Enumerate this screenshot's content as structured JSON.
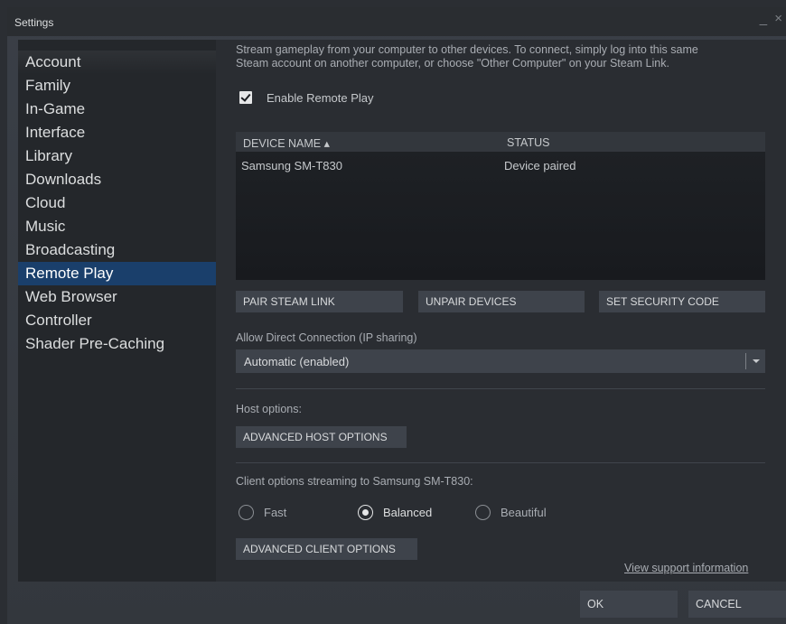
{
  "window": {
    "title": "Settings",
    "controls": "_ ×"
  },
  "sidebar": {
    "items": [
      {
        "label": "Account"
      },
      {
        "label": "Family"
      },
      {
        "label": "In-Game"
      },
      {
        "label": "Interface"
      },
      {
        "label": "Library"
      },
      {
        "label": "Downloads"
      },
      {
        "label": "Cloud"
      },
      {
        "label": "Music"
      },
      {
        "label": "Broadcasting"
      },
      {
        "label": "Remote Play"
      },
      {
        "label": "Web Browser"
      },
      {
        "label": "Controller"
      },
      {
        "label": "Shader Pre-Caching"
      }
    ],
    "active": "Remote Play"
  },
  "main": {
    "intro_line1": "Stream gameplay from your computer to other devices. To connect, simply log into this same",
    "intro_line2": "Steam account on another computer, or choose \"Other Computer\" on your Steam Link.",
    "enable_remote_play": {
      "label": "Enable Remote Play",
      "checked": true
    },
    "devices": {
      "columns": [
        "DEVICE NAME ▴",
        "STATUS"
      ],
      "rows": [
        {
          "name": "Samsung SM-T830",
          "status": "Device paired"
        }
      ]
    },
    "buttons": {
      "pair": "PAIR STEAM LINK",
      "unpair": "UNPAIR DEVICES",
      "security": "SET SECURITY CODE"
    },
    "direct_connection": {
      "label": "Allow Direct Connection (IP sharing)",
      "value": "Automatic (enabled)"
    },
    "host": {
      "label": "Host options:",
      "button": "ADVANCED HOST OPTIONS"
    },
    "client": {
      "label": "Client options streaming to Samsung SM-T830:",
      "options": [
        {
          "label": "Fast",
          "selected": false
        },
        {
          "label": "Balanced",
          "selected": true
        },
        {
          "label": "Beautiful",
          "selected": false
        }
      ],
      "button": "ADVANCED CLIENT OPTIONS"
    },
    "support_link": "View support information"
  },
  "footer": {
    "ok": "OK",
    "cancel": "CANCEL"
  },
  "colors": {
    "active_sidebar": "#1a3f6b",
    "background": "#2a2d32",
    "sidebar": "#24272b",
    "button": "#3e434b"
  }
}
